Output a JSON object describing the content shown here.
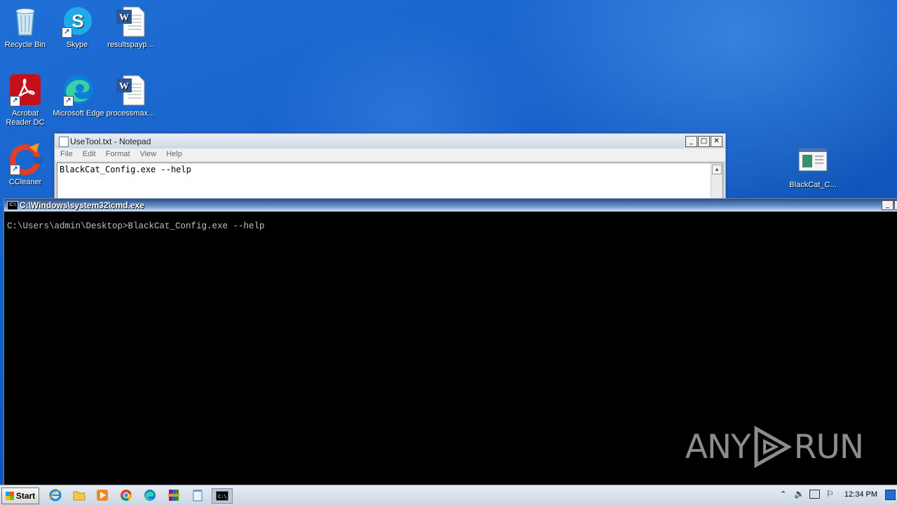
{
  "desktop": {
    "icons": [
      {
        "label": "Recycle Bin"
      },
      {
        "label": "Skype"
      },
      {
        "label": "resultspayp..."
      },
      {
        "label": "Acrobat Reader DC"
      },
      {
        "label": "Microsoft Edge"
      },
      {
        "label": "processmax..."
      },
      {
        "label": "CCleaner"
      },
      {
        "label": "BlackCat_C..."
      }
    ]
  },
  "notepad": {
    "title": "UseTool.txt - Notepad",
    "menu": [
      "File",
      "Edit",
      "Format",
      "View",
      "Help"
    ],
    "content": "BlackCat_Config.exe --help"
  },
  "cmd": {
    "title": "C:\\Windows\\system32\\cmd.exe",
    "line": "C:\\Users\\admin\\Desktop>BlackCat_Config.exe --help"
  },
  "watermark": {
    "left": "ANY",
    "right": "RUN"
  },
  "taskbar": {
    "start_label": "Start",
    "clock": "12:34 PM"
  },
  "colors": {
    "desktop": "#1560c8",
    "cmd_bg": "#000000",
    "cmd_text": "#c0c0c0"
  }
}
